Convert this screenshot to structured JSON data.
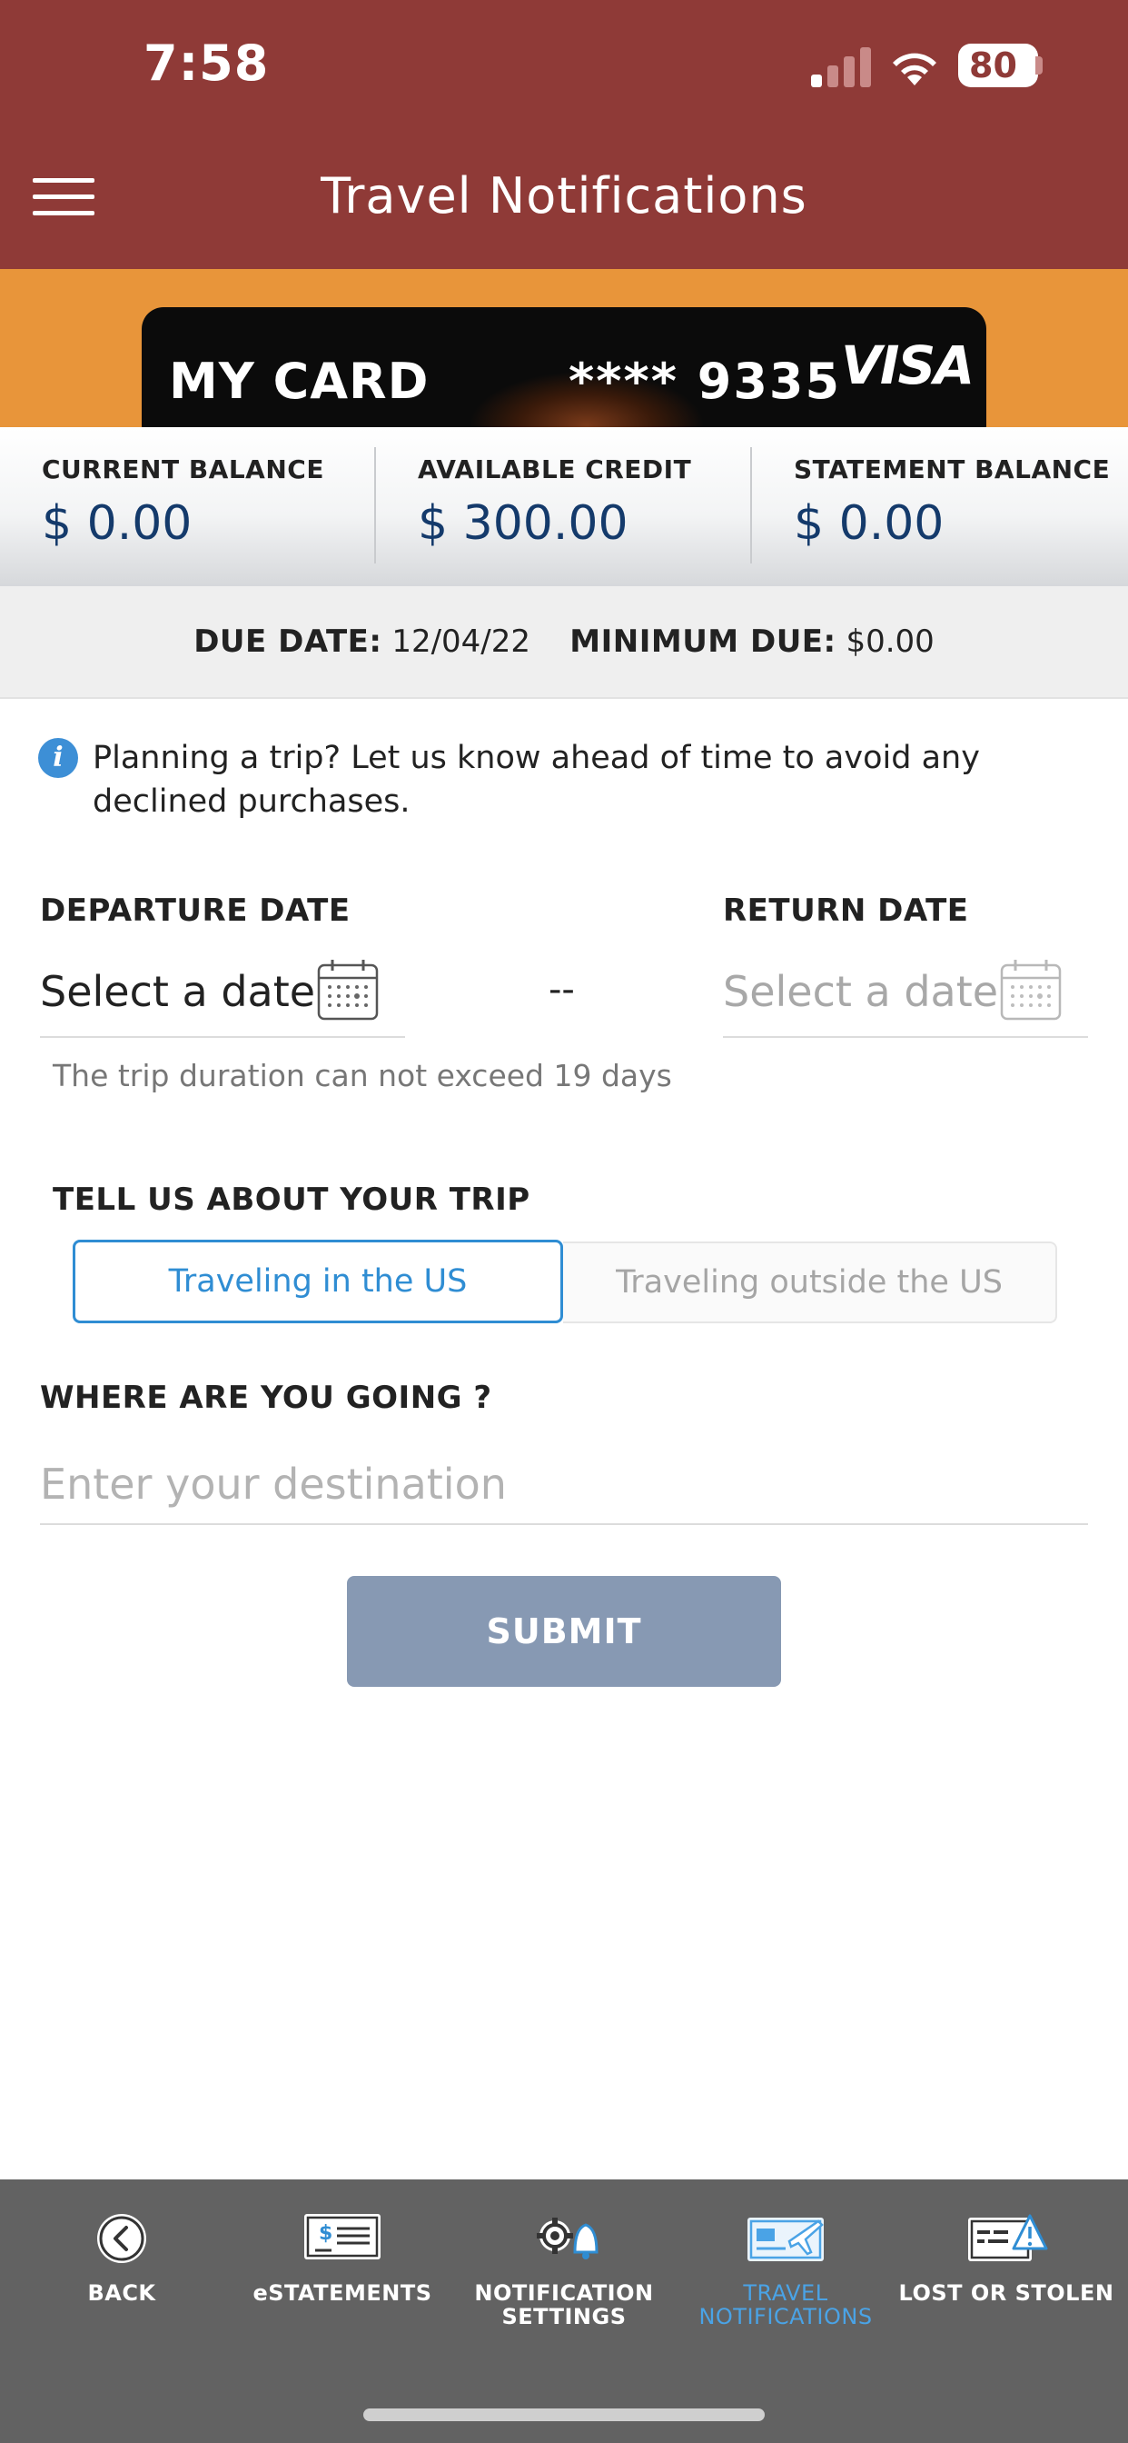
{
  "status": {
    "time": "7:58",
    "battery": "80"
  },
  "header": {
    "title": "Travel Notifications"
  },
  "card": {
    "name": "MY CARD",
    "number": "**** 9335",
    "brand": "VISA"
  },
  "balances": [
    {
      "label": "CURRENT BALANCE",
      "value": "$ 0.00"
    },
    {
      "label": "AVAILABLE CREDIT",
      "value": "$ 300.00"
    },
    {
      "label": "STATEMENT BALANCE",
      "value": "$ 0.00"
    }
  ],
  "due": {
    "due_label": "DUE DATE:",
    "due_value": "12/04/22",
    "min_label": "MINIMUM DUE:",
    "min_value": "$0.00"
  },
  "info": {
    "text": "Planning a trip? Let us know ahead of time to avoid any declined purchases."
  },
  "dates": {
    "departure_label": "DEPARTURE DATE",
    "departure_value": "Select a date",
    "return_label": "RETURN DATE",
    "return_value": "Select a date",
    "separator": "--",
    "hint": "The trip duration can not exceed 19 days"
  },
  "trip": {
    "label": "TELL US ABOUT YOUR TRIP",
    "options": [
      "Traveling in the US",
      "Traveling outside the US"
    ],
    "selected": "Traveling in the US"
  },
  "destination": {
    "label": "WHERE ARE YOU GOING ?",
    "placeholder": "Enter your destination",
    "value": ""
  },
  "submit": {
    "label": "SUBMIT"
  },
  "tabs": [
    {
      "label": "BACK",
      "icon": "back-circle-icon",
      "active": false
    },
    {
      "label": "eSTATEMENTS",
      "icon": "statement-check-icon",
      "active": false
    },
    {
      "label": "NOTIFICATION SETTINGS",
      "icon": "gear-bell-icon",
      "active": false
    },
    {
      "label": "TRAVEL NOTIFICATIONS",
      "icon": "card-plane-icon",
      "active": true
    },
    {
      "label": "LOST OR STOLEN",
      "icon": "card-warning-icon",
      "active": false
    }
  ],
  "colors": {
    "header": "#8f3a37",
    "banner": "#e8953a",
    "accent": "#2f8dd3",
    "tabbar": "#626262",
    "active_tab": "#4aa3e6"
  }
}
